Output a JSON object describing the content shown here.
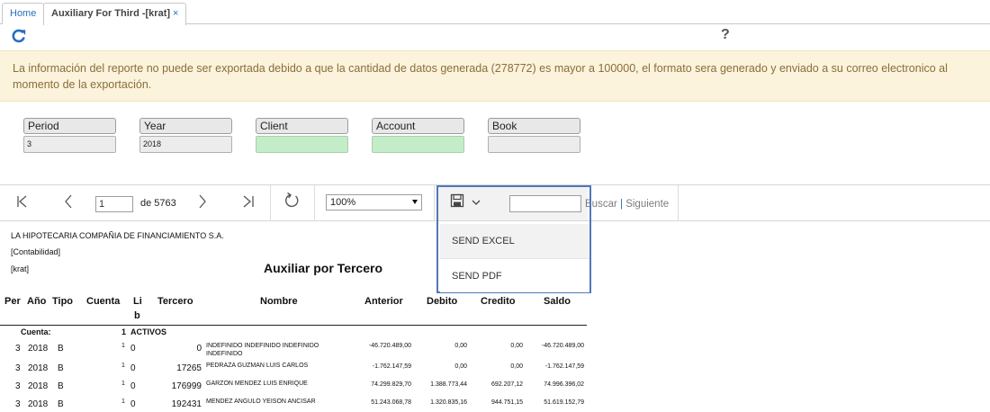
{
  "tabs": [
    {
      "label": "Home"
    },
    {
      "label": "Auxiliary For Third -[krat]",
      "close": "×"
    }
  ],
  "help_symbol": "?",
  "warning": "La información del reporte no puede ser exportada debido a que la cantidad de datos generada (278772) es mayor a 100000, el formato sera generado y enviado a su correo electronico al momento de la exportación.",
  "params": [
    {
      "label": "Period",
      "value": "3"
    },
    {
      "label": "Year",
      "value": "2018"
    },
    {
      "label": "Client",
      "value": ""
    },
    {
      "label": "Account",
      "value": ""
    },
    {
      "label": "Book",
      "value": ""
    }
  ],
  "toolbar": {
    "page": "1",
    "page_of": "de 5763",
    "zoom": "100%",
    "search_label": "Buscar",
    "pipe": "|",
    "next_label": "Siguiente"
  },
  "export_menu": {
    "excel": "SEND EXCEL",
    "pdf": "SEND PDF"
  },
  "report": {
    "company": "LA HIPOTECARIA COMPAÑIA DE FINANCIAMIENTO S.A.",
    "line2": "[Contabilidad]",
    "line3": "[krat]",
    "title": "Auxiliar por Tercero",
    "headers": {
      "per": "Per",
      "anio": "Año",
      "tipo": "Tipo",
      "cuenta": "Cuenta",
      "lib1": "Li",
      "lib2": "b",
      "tercero": "Tercero",
      "nombre": "Nombre",
      "anterior": "Anterior",
      "debito": "Debito",
      "credito": "Credito",
      "saldo": "Saldo"
    },
    "cuenta_label": "Cuenta:",
    "cuenta_num": "1",
    "cuenta_name": "ACTIVOS",
    "rows": [
      {
        "per": "3",
        "anio": "2018",
        "tipo": "B",
        "lib": "1",
        "libz": "0",
        "tercero": "0",
        "nombre": "INDEFINIDO INDEFINIDO INDEFINIDO",
        "nombre2": "INDEFINIDO",
        "anterior": "-46.720.489,00",
        "debito": "0,00",
        "credito": "0,00",
        "saldo": "-46.720.489,00"
      },
      {
        "per": "3",
        "anio": "2018",
        "tipo": "B",
        "lib": "1",
        "libz": "0",
        "tercero": "17265",
        "nombre": "PEDRAZA GUZMAN LUIS CARLOS",
        "nombre2": "",
        "anterior": "-1.762.147,59",
        "debito": "0,00",
        "credito": "0,00",
        "saldo": "-1.762.147,59"
      },
      {
        "per": "3",
        "anio": "2018",
        "tipo": "B",
        "lib": "1",
        "libz": "0",
        "tercero": "176999",
        "nombre": "GARZON MENDEZ LUIS ENRIQUE",
        "nombre2": "",
        "anterior": "74.299.829,70",
        "debito": "1.388.773,44",
        "credito": "692.207,12",
        "saldo": "74.996.396,02"
      },
      {
        "per": "3",
        "anio": "2018",
        "tipo": "B",
        "lib": "1",
        "libz": "0",
        "tercero": "192431",
        "nombre": "MENDEZ ANGULO YEISON  ANCISAR",
        "nombre2": "",
        "anterior": "51.243.068,78",
        "debito": "1.320.835,16",
        "credito": "944.751,15",
        "saldo": "51.619.152,79"
      }
    ]
  },
  "colors": {
    "accent": "#2a6ebb",
    "warning_bg": "#fcf3dc",
    "warning_text": "#8a6d3b",
    "field_green": "#c4ecc9",
    "dropdown_border": "#4f79b8"
  }
}
